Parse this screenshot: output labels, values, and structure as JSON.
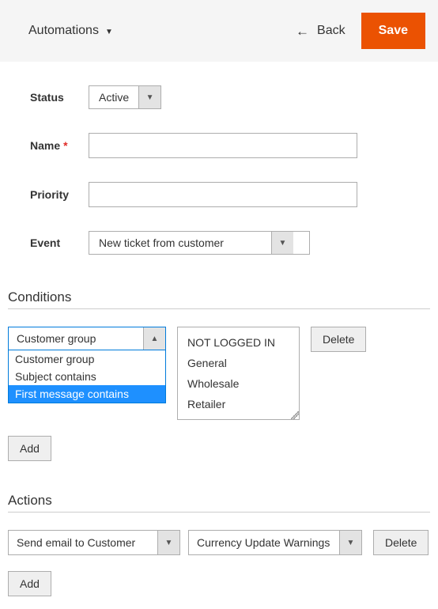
{
  "header": {
    "breadcrumb": "Automations",
    "back_label": "Back",
    "save_label": "Save"
  },
  "form": {
    "status_label": "Status",
    "status_value": "Active",
    "name_label": "Name",
    "name_value": "",
    "priority_label": "Priority",
    "priority_value": "",
    "event_label": "Event",
    "event_value": "New ticket from customer"
  },
  "conditions": {
    "title": "Conditions",
    "selector_value": "Customer group",
    "selector_options": [
      {
        "label": "Customer group",
        "selected": false
      },
      {
        "label": "Subject contains",
        "selected": false
      },
      {
        "label": "First message contains",
        "selected": true
      }
    ],
    "list_values": [
      "NOT LOGGED IN",
      "General",
      "Wholesale",
      "Retailer"
    ],
    "delete_label": "Delete",
    "add_label": "Add"
  },
  "actions": {
    "title": "Actions",
    "type_value": "Send email to Customer",
    "template_value": "Currency Update Warnings",
    "delete_label": "Delete",
    "add_label": "Add"
  }
}
